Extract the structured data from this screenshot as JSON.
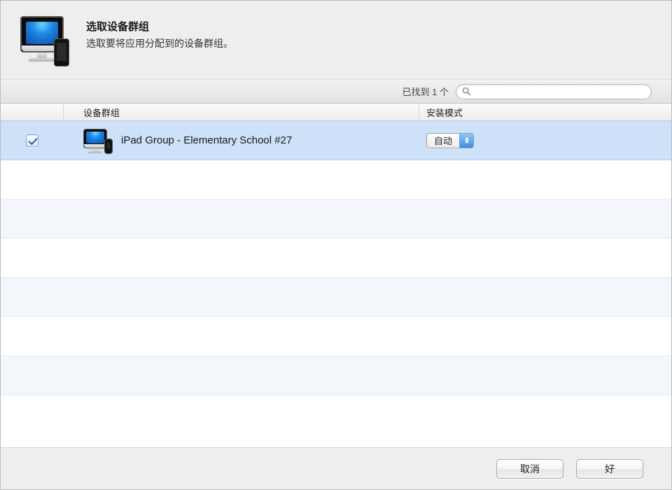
{
  "header": {
    "title": "选取设备群组",
    "subtitle": "选取要将应用分配到的设备群组。"
  },
  "search": {
    "found_label": "已找到 1 个",
    "placeholder": ""
  },
  "table": {
    "columns": {
      "group": "设备群组",
      "mode": "安装模式"
    },
    "rows": [
      {
        "checked": true,
        "icon": "devices-icon",
        "name": "iPad Group - Elementary School #27",
        "mode": "自动"
      }
    ]
  },
  "footer": {
    "cancel": "取消",
    "ok": "好"
  }
}
